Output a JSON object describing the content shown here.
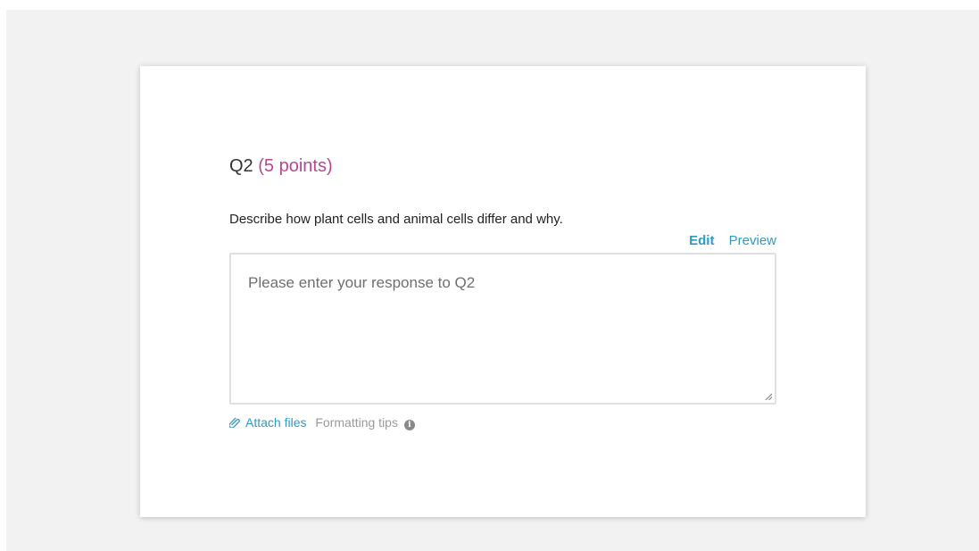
{
  "question": {
    "label": "Q2",
    "points": "(5 points)",
    "prompt": "Describe how plant cells and animal cells differ and why."
  },
  "editor": {
    "tabs": {
      "edit": "Edit",
      "preview": "Preview"
    },
    "placeholder": "Please enter your response to Q2",
    "value": ""
  },
  "footer": {
    "attach_label": "Attach files",
    "formatting_label": "Formatting tips",
    "info_glyph": "i"
  },
  "colors": {
    "accent": "#2f9ac4",
    "points": "#b44a8e",
    "backdrop": "#f2f2f2"
  },
  "icons": [
    "paperclip-icon",
    "info-icon",
    "resize-grip-icon"
  ]
}
